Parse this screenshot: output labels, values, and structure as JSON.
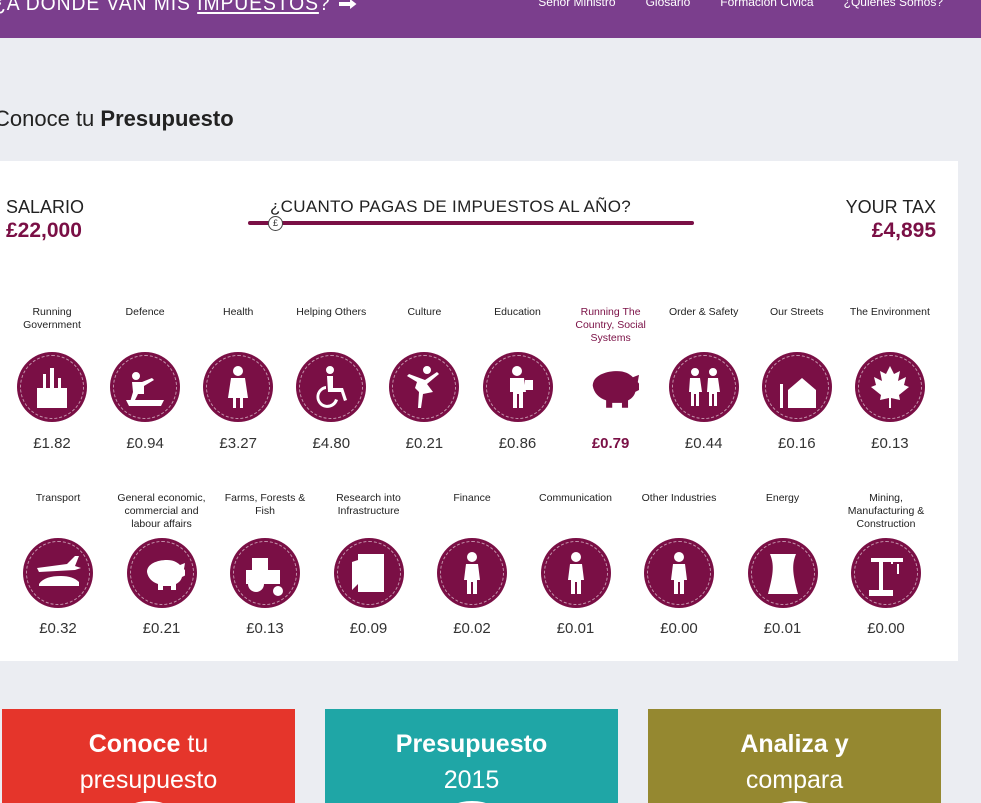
{
  "header": {
    "logo_text": "¿A DÓNDE VAN MIS",
    "logo_text_underlined": "IMPUESTOS",
    "logo_q": "?",
    "nav": [
      "Señor Ministro",
      "Glosario",
      "Formación Cívica",
      "¿Quiénes Somos?"
    ]
  },
  "page": {
    "title_normal": "Conoce tu ",
    "title_bold": "Presupuesto"
  },
  "calculator": {
    "salary_label": "SALARIO",
    "salary_value": "£22,000",
    "question": "¿CUANTO PAGAS DE IMPUESTOS AL AÑO?",
    "slider_handle": "£",
    "tax_label": "YOUR TAX",
    "tax_value": "£4,895"
  },
  "categories_row1": [
    {
      "label": "Running Government",
      "value": "£1.82",
      "icon": "city-hall-icon"
    },
    {
      "label": "Defence",
      "value": "£0.94",
      "icon": "soldier-tank-icon"
    },
    {
      "label": "Health",
      "value": "£3.27",
      "icon": "nurse-icon"
    },
    {
      "label": "Helping Others",
      "value": "£4.80",
      "icon": "wheelchair-icon"
    },
    {
      "label": "Culture",
      "value": "£0.21",
      "icon": "ballerina-icon"
    },
    {
      "label": "Education",
      "value": "£0.86",
      "icon": "teacher-icon"
    },
    {
      "label": "Running The Country, Social Systems",
      "value": "£0.79",
      "icon": "piggy-bank-icon",
      "highlight": true
    },
    {
      "label": "Order & Safety",
      "value": "£0.44",
      "icon": "police-icon"
    },
    {
      "label": "Our Streets",
      "value": "£0.16",
      "icon": "street-house-icon"
    },
    {
      "label": "The Environment",
      "value": "£0.13",
      "icon": "maple-leaf-icon"
    }
  ],
  "categories_row2": [
    {
      "label": "Transport",
      "value": "£0.32",
      "icon": "plane-car-icon"
    },
    {
      "label": "General economic, commercial and labour affairs",
      "value": "£0.21",
      "icon": "piggy-bank-icon"
    },
    {
      "label": "Farms, Forests & Fish",
      "value": "£0.13",
      "icon": "tractor-icon"
    },
    {
      "label": "Research into Infrastructure",
      "value": "£0.09",
      "icon": "notebook-icon"
    },
    {
      "label": "Finance",
      "value": "£0.02",
      "icon": "person-icon"
    },
    {
      "label": "Communication",
      "value": "£0.01",
      "icon": "person-icon"
    },
    {
      "label": "Other Industries",
      "value": "£0.00",
      "icon": "person-icon"
    },
    {
      "label": "Energy",
      "value": "£0.01",
      "icon": "cooling-tower-icon"
    },
    {
      "label": "Mining, Manufacturing & Construction",
      "value": "£0.00",
      "icon": "crane-icon"
    }
  ],
  "cards": [
    {
      "bold": "Conoce",
      "rest": " tu",
      "line2": "presupuesto",
      "color": "#e5352b"
    },
    {
      "bold": "Presupuesto",
      "rest": "",
      "line2": "2015",
      "color": "#1fa6a6"
    },
    {
      "bold": "Analiza y",
      "rest": "",
      "line2": "compara",
      "color": "#958830"
    }
  ],
  "colors": {
    "header": "#7b3e8d",
    "accent": "#7a0f45",
    "background": "#ebedf2"
  }
}
